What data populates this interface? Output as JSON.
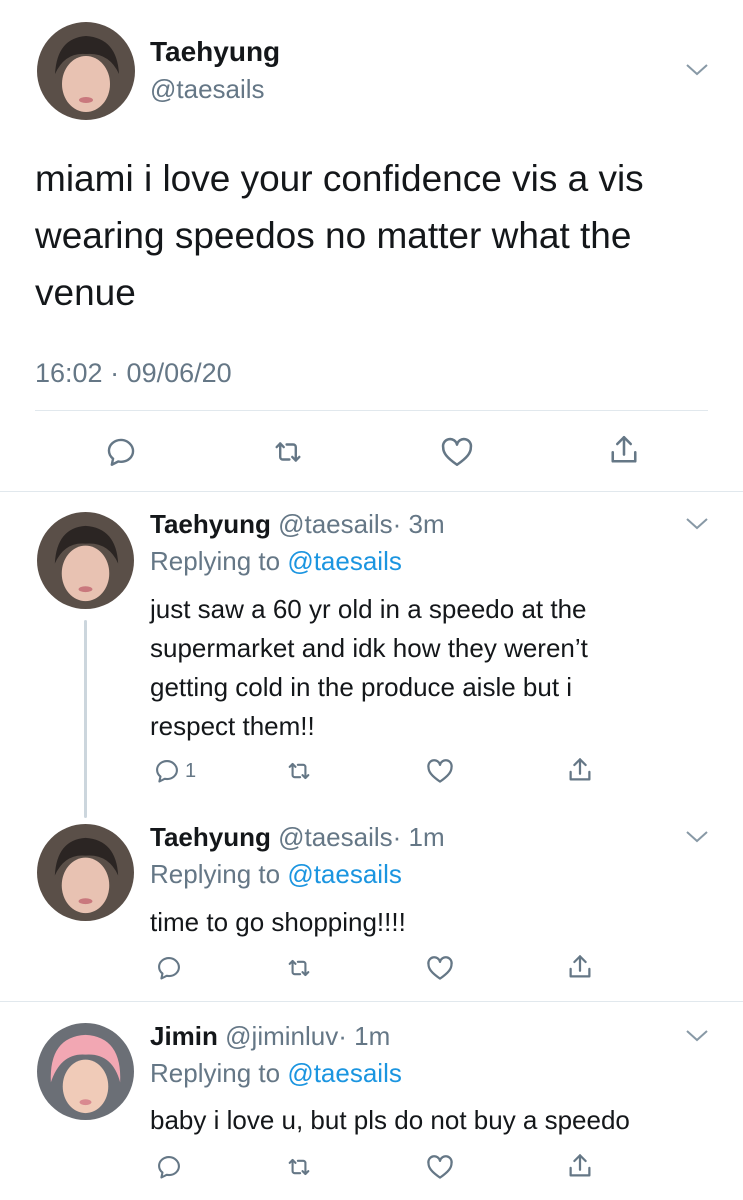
{
  "main_tweet": {
    "name": "Taehyung",
    "handle": "@taesails",
    "text_lines": [
      "miami i love your confidence vis a vis",
      "wearing speedos no matter what the",
      "venue"
    ],
    "timestamp": "16:02 · 09/06/20"
  },
  "replies": [
    {
      "name": "Taehyung",
      "handle": "@taesails",
      "time": "· 3m",
      "replying_prefix": "Replying to",
      "replying_to": "@taesails",
      "text_lines": [
        "just saw a 60 yr old in a speedo at the",
        "supermarket and idk how they weren’t",
        "getting cold in the produce aisle but i",
        "respect them!!"
      ],
      "reply_count": "1"
    },
    {
      "name": "Taehyung",
      "handle": "@taesails",
      "time": "· 1m",
      "replying_prefix": "Replying to",
      "replying_to": "@taesails",
      "text_lines": [
        "time to go shopping!!!!"
      ],
      "reply_count": ""
    },
    {
      "name": "Jimin",
      "handle": "@jiminluv",
      "time": "· 1m",
      "replying_prefix": "Replying to",
      "replying_to": "@taesails",
      "text_lines": [
        "baby i love u, but pls do not buy a speedo"
      ],
      "reply_count": ""
    }
  ],
  "icons": [
    "reply-icon",
    "retweet-icon",
    "like-icon",
    "share-icon",
    "chevron-down-icon"
  ],
  "colors": {
    "text": "#14171a",
    "muted": "#657786",
    "link": "#1b95e0",
    "divider": "#e1e8ed",
    "thread_line": "#ccd6dd",
    "jimin_hair": "#f2a7b3"
  }
}
